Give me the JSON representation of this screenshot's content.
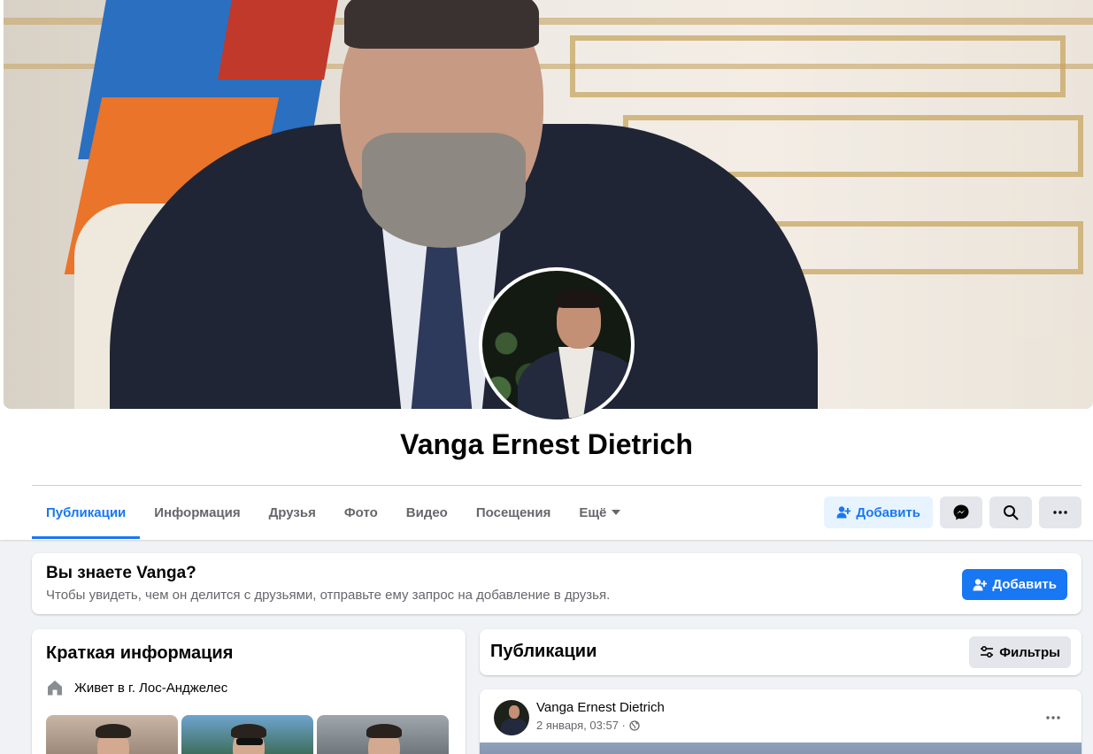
{
  "profile": {
    "name": "Vanga Ernest Dietrich"
  },
  "tabs": [
    {
      "label": "Публикации",
      "active": true
    },
    {
      "label": "Информация",
      "active": false
    },
    {
      "label": "Друзья",
      "active": false
    },
    {
      "label": "Фото",
      "active": false
    },
    {
      "label": "Видео",
      "active": false
    },
    {
      "label": "Посещения",
      "active": false
    },
    {
      "label": "Ещё",
      "active": false
    }
  ],
  "actions": {
    "add_label": "Добавить",
    "messenger_icon": "messenger-icon",
    "search_icon": "search-icon",
    "more_icon": "more-icon"
  },
  "know": {
    "title": "Вы знаете Vanga?",
    "subtitle": "Чтобы увидеть, чем он делится с друзьями, отправьте ему запрос на добавление в друзья.",
    "add_label": "Добавить"
  },
  "intro": {
    "title": "Краткая информация",
    "lives_in": "Живет в г. Лос-Анджелес"
  },
  "posts": {
    "title": "Публикации",
    "filters_label": "Фильтры"
  },
  "post": {
    "author": "Vanga Ernest Dietrich",
    "date": "2 января, 03:57 ·"
  },
  "colors": {
    "accent": "#1877f2",
    "accent_light": "#e7f3ff",
    "page_bg": "#f0f2f5",
    "secondary_text": "#65676b"
  }
}
